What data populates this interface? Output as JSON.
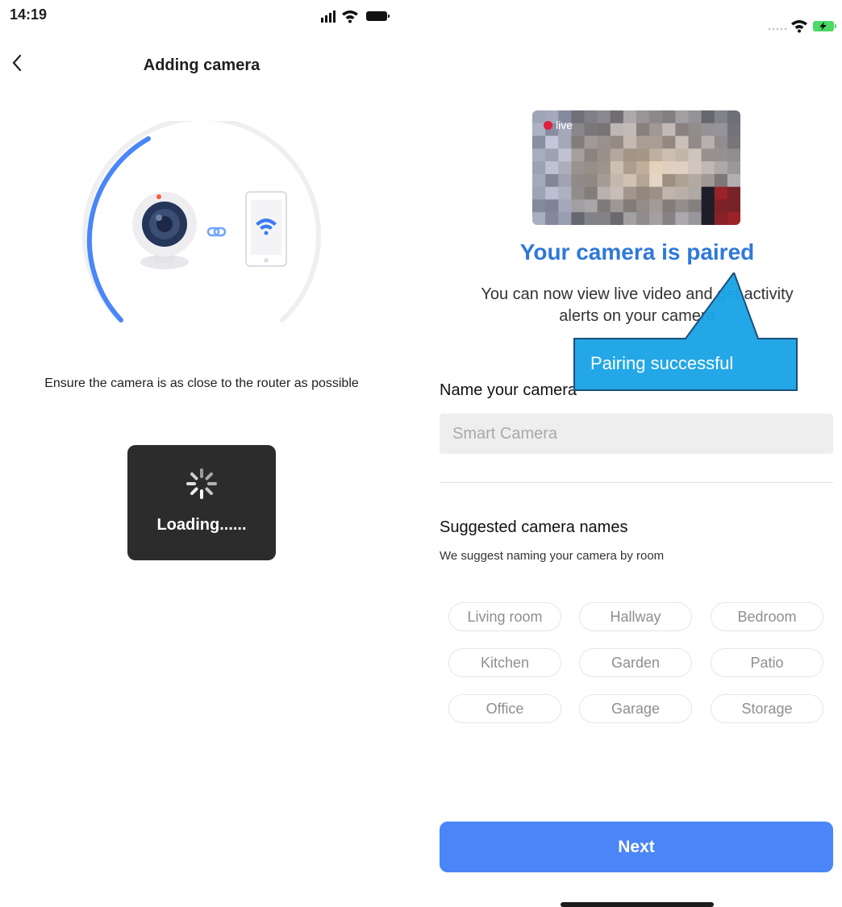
{
  "left": {
    "status_time": "14:19",
    "back_icon": "chevron-left-icon",
    "title": "Adding camera",
    "hint": "Ensure the camera is as close to the router as possible",
    "toast_text": "Loading......"
  },
  "right": {
    "preview_badge": "live",
    "paired_title": "Your camera is paired",
    "paired_desc_line1": "You can now view live video and get activity",
    "paired_desc_line2": "alerts on your camera",
    "callout_text": "Pairing successful",
    "name_label": "Name your camera",
    "name_placeholder": "Smart Camera",
    "suggested_title": "Suggested camera names",
    "suggested_sub": "We suggest naming your camera by room",
    "chips": [
      "Living room",
      "Hallway",
      "Bedroom",
      "Kitchen",
      "Garden",
      "Patio",
      "Office",
      "Garage",
      "Storage"
    ],
    "next_label": "Next"
  },
  "colors": {
    "accent_blue": "#2f78d9",
    "button_blue": "#4a86f7",
    "callout_fill": "#1aa3e6",
    "toast_bg": "#2c2c2c"
  }
}
